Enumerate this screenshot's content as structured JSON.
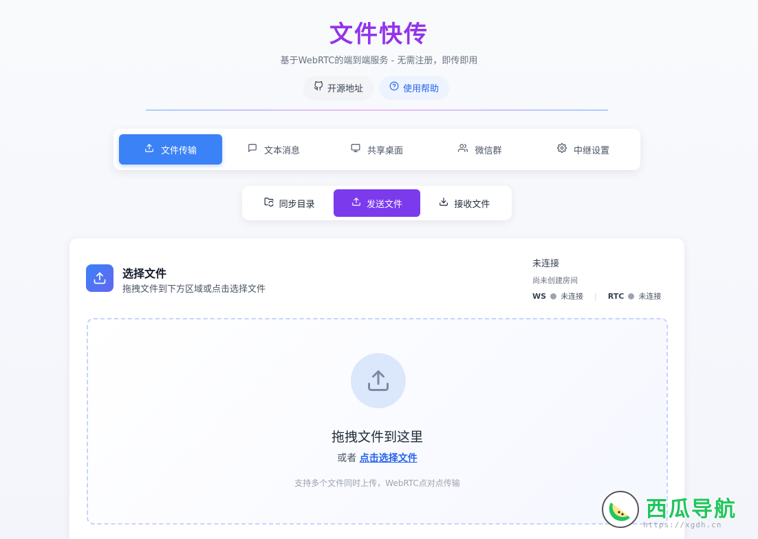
{
  "header": {
    "title": "文件快传",
    "subtitle": "基于WebRTC的端到端服务 - 无需注册，即传即用",
    "links": [
      {
        "label": "开源地址",
        "icon": "github-icon"
      },
      {
        "label": "使用帮助",
        "icon": "help-circle-icon"
      }
    ]
  },
  "main_tabs": [
    {
      "label": "文件传输",
      "icon": "upload-icon",
      "active": true
    },
    {
      "label": "文本消息",
      "icon": "message-icon",
      "active": false
    },
    {
      "label": "共享桌面",
      "icon": "monitor-icon",
      "active": false
    },
    {
      "label": "微信群",
      "icon": "users-icon",
      "active": false
    },
    {
      "label": "中继设置",
      "icon": "gear-icon",
      "active": false
    }
  ],
  "sub_tabs": [
    {
      "label": "同步目录",
      "icon": "folder-sync-icon",
      "active": false
    },
    {
      "label": "发送文件",
      "icon": "upload-icon",
      "active": true
    },
    {
      "label": "接收文件",
      "icon": "download-icon",
      "active": false
    }
  ],
  "card": {
    "title": "选择文件",
    "description": "拖拽文件到下方区域或点击选择文件",
    "status": {
      "connection": "未连接",
      "room": "尚未创建房间",
      "ws_label": "WS",
      "ws_state": "未连接",
      "rtc_label": "RTC",
      "rtc_state": "未连接",
      "separator": "|"
    },
    "dropzone": {
      "title": "拖拽文件到这里",
      "or_text": "或者",
      "select_link": "点击选择文件",
      "hint": "支持多个文件同时上传，WebRTC点对点传输"
    }
  },
  "watermark": {
    "text": "西瓜导航",
    "url": "https://xgdh.cn"
  },
  "colors": {
    "title": "#9333ea",
    "main_tab_active": "#3b82f6",
    "sub_tab_active": "#7c3aed",
    "link": "#2563eb"
  }
}
